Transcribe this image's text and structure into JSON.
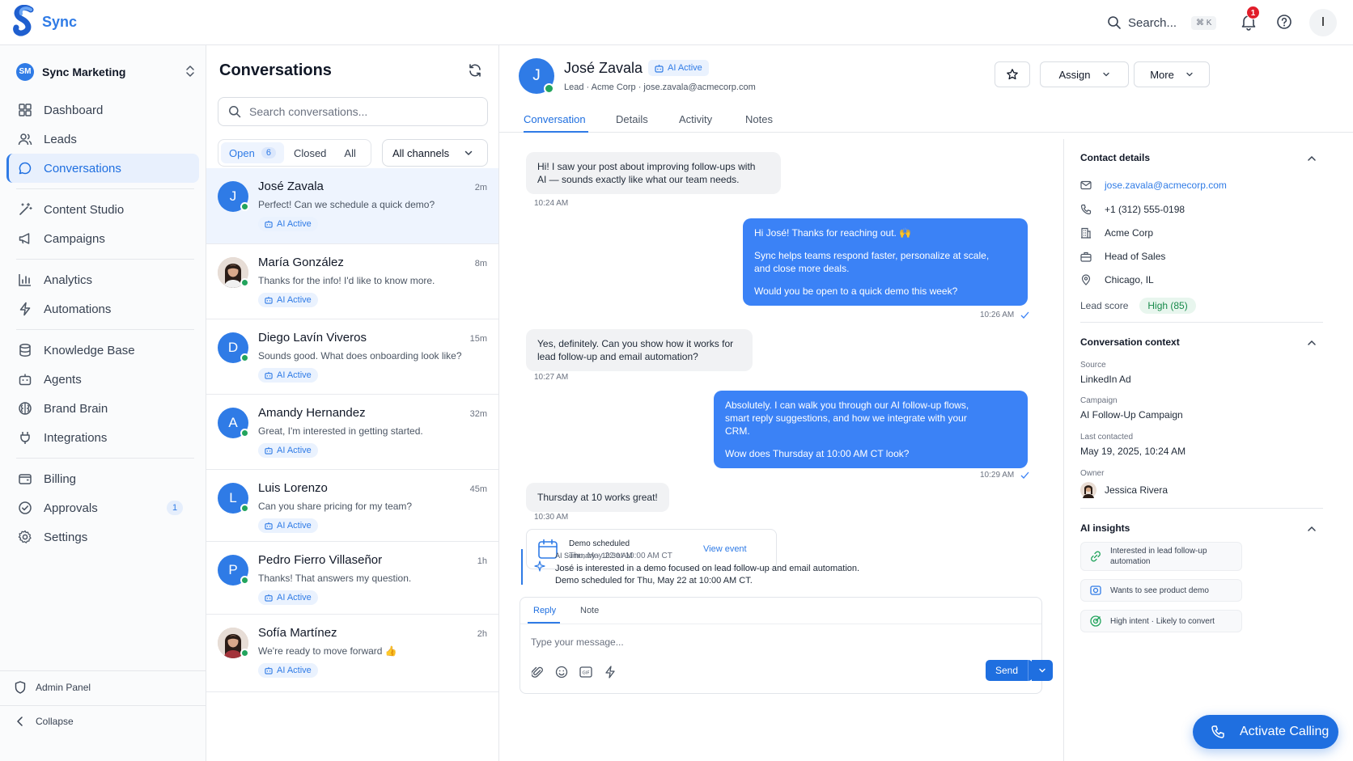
{
  "app": {
    "name": "Sync"
  },
  "topbar": {
    "search_label": "Search...",
    "search_shortcut": "⌘ K",
    "notifications_count": "1",
    "user_initial": "I"
  },
  "workspace": {
    "initials": "SM",
    "name": "Sync Marketing"
  },
  "nav": {
    "dashboard": "Dashboard",
    "leads": "Leads",
    "conversations": "Conversations",
    "content_studio": "Content Studio",
    "campaigns": "Campaigns",
    "analytics": "Analytics",
    "automations": "Automations",
    "knowledge_base": "Knowledge Base",
    "agents": "Agents",
    "brand_brain": "Brand Brain",
    "integrations": "Integrations",
    "billing": "Billing",
    "approvals": "Approvals",
    "approvals_badge": "1",
    "settings": "Settings",
    "admin_panel": "Admin Panel",
    "collapse": "Collapse"
  },
  "conv_list": {
    "title": "Conversations",
    "search_placeholder": "Search conversations...",
    "filters": {
      "open": "Open",
      "open_count": "6",
      "closed": "Closed",
      "all": "All",
      "channels": "All channels"
    },
    "items": [
      {
        "initial": "J",
        "name": "José Zavala",
        "time": "2m",
        "message": "Perfect! Can we schedule a quick demo?",
        "badge": "AI Active"
      },
      {
        "initial": "",
        "name": "María González",
        "time": "8m",
        "message": "Thanks for the info! I'd like to know more.",
        "badge": "AI Active"
      },
      {
        "initial": "D",
        "name": "Diego Lavín Viveros",
        "time": "15m",
        "message": "Sounds good. What does onboarding look like?",
        "badge": "AI Active"
      },
      {
        "initial": "A",
        "name": "Amandy Hernandez",
        "time": "32m",
        "message": "Great, I'm interested in getting started.",
        "badge": "AI Active"
      },
      {
        "initial": "L",
        "name": "Luis Lorenzo",
        "time": "45m",
        "message": "Can you share pricing for my team?",
        "badge": "AI Active"
      },
      {
        "initial": "P",
        "name": "Pedro Fierro Villaseñor",
        "time": "1h",
        "message": "Thanks! That answers my question.",
        "badge": "AI Active"
      },
      {
        "initial": "",
        "name": "Sofía Martínez",
        "time": "2h",
        "message": "We're ready to move forward 👍",
        "badge": "AI Active"
      }
    ]
  },
  "contact": {
    "initial": "J",
    "name": "José Zavala",
    "ai_badge": "AI Active",
    "subtitle": "Lead · Acme Corp · jose.zavala@acmecorp.com"
  },
  "header_actions": {
    "assign": "Assign",
    "more": "More"
  },
  "tabs": {
    "conversation": "Conversation",
    "details": "Details",
    "activity": "Activity",
    "notes": "Notes"
  },
  "messages": {
    "m1": {
      "line1": "Hi! I saw your post about improving follow-ups with",
      "line2": "AI — sounds exactly like what our team needs.",
      "time": "10:24 AM"
    },
    "m2": {
      "line1": "Hi José! Thanks for reaching out. 🙌",
      "line2": "Sync helps teams respond faster, personalize at scale,",
      "line3": "and close more deals.",
      "line4": "Would you be open to a quick demo this week?",
      "time": "10:26 AM"
    },
    "m3": {
      "line1": "Yes, definitely. Can you show how it works for",
      "line2": "lead follow-up and email automation?",
      "time": "10:27 AM"
    },
    "m4": {
      "line1": "Absolutely. I can walk you through our AI follow-up flows,",
      "line2": "smart reply suggestions, and how we integrate with your",
      "line3": "CRM.",
      "line4": "Wow does Thursday at 10:00 AM CT look?",
      "time": "10:29 AM"
    },
    "m5": {
      "line1": "Thursday at 10 works great!",
      "time": "10:30 AM"
    }
  },
  "event": {
    "title": "Demo scheduled",
    "date": "Thu, May 22 at 10:00 AM CT",
    "link": "View event"
  },
  "ai_summary": {
    "label": "AI Summary · 10:30 AM",
    "line1": "José is interested in a demo focused on lead follow-up and email automation.",
    "line2": "Demo scheduled for Thu, May 22 at 10:00 AM CT."
  },
  "composer": {
    "tab_reply": "Reply",
    "tab_note": "Note",
    "placeholder": "Type your message...",
    "send": "Send"
  },
  "details": {
    "title": "Contact details",
    "email": "jose.zavala@acmecorp.com",
    "phone": "+1 (312) 555-0198",
    "company": "Acme Corp",
    "role": "Head of Sales",
    "location": "Chicago, IL",
    "lead_score_label": "Lead score",
    "lead_score_value": "High (85)"
  },
  "context": {
    "title": "Conversation context",
    "source_label": "Source",
    "source": "LinkedIn Ad",
    "campaign_label": "Campaign",
    "campaign": "AI Follow-Up Campaign",
    "last_contacted_label": "Last contacted",
    "last_contacted": "May 19, 2025, 10:24 AM",
    "owner_label": "Owner",
    "owner": "Jessica Rivera"
  },
  "insights": {
    "title": "AI insights",
    "i1_line1": "Interested in lead follow-up",
    "i1_line2": "automation",
    "i2": "Wants to see product demo",
    "i3": "High intent · Likely to convert"
  },
  "calling": {
    "label": "Activate Calling"
  },
  "colors": {
    "accent": "#2f7be6",
    "online": "#22a45d",
    "notification": "#e11d2a"
  }
}
